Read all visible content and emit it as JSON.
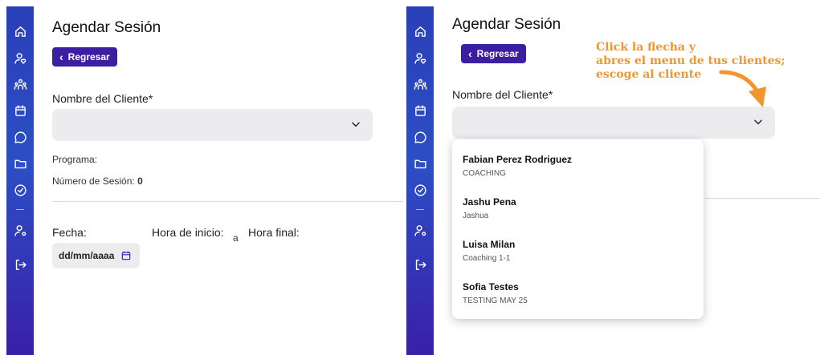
{
  "sidebar": {
    "icons": [
      "home-icon",
      "user-heart-icon",
      "group-icon",
      "calendar-icon",
      "chat-icon",
      "folder-icon",
      "check-circle-icon",
      "user-settings-icon",
      "logout-icon"
    ]
  },
  "left_panel": {
    "title": "Agendar Sesión",
    "back_label": "Regresar",
    "client_label": "Nombre del Cliente*",
    "program_label": "Programa:",
    "session_number_label": "Número de Sesión:",
    "session_number_value": "0",
    "date_label": "Fecha:",
    "start_label": "Hora de inicio:",
    "a_label": "a",
    "end_label": "Hora final:",
    "date_placeholder": "dd/mm/aaaa"
  },
  "right_panel": {
    "title": "Agendar Sesión",
    "back_label": "Regresar",
    "client_label": "Nombre del Cliente*",
    "annotation": [
      "Click la flecha y",
      "abres el menu de tus clientes;",
      "escoge al cliente"
    ],
    "clients": [
      {
        "name": "Fabian Perez Rodriguez",
        "program": "COACHING"
      },
      {
        "name": "Jashu Pena",
        "program": "Jashua"
      },
      {
        "name": "Luisa Milan",
        "program": "Coaching 1-1"
      },
      {
        "name": "Sofia Testes",
        "program": "TESTING MAY 25"
      }
    ]
  },
  "colors": {
    "accent": "#3b1fa3",
    "annotation": "#f0952f",
    "field_bg": "#ececef"
  }
}
